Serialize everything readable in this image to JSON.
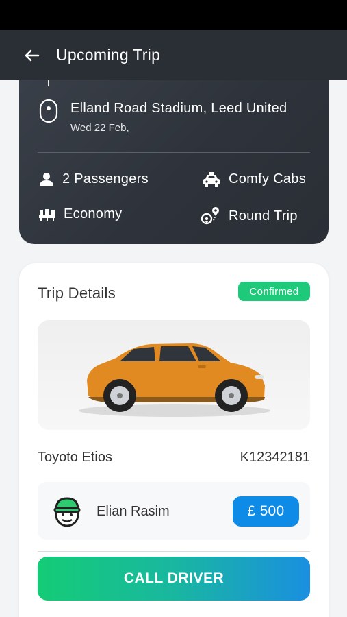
{
  "header": {
    "title": "Upcoming Trip",
    "back_icon": "arrow-left-icon"
  },
  "trip": {
    "location": "Elland Road Stadium, Leed United",
    "date": "Wed 22 Feb,",
    "passengers": "2 Passengers",
    "cab_company": "Comfy Cabs",
    "class": "Economy",
    "trip_type": "Round Trip"
  },
  "details": {
    "title": "Trip Details",
    "status": "Confirmed",
    "car_model": "Toyoto Etios",
    "car_plate": "K12342181",
    "driver_name": "Elian Rasim",
    "price": "£ 500",
    "call_label": "CALL DRIVER"
  },
  "colors": {
    "header_bg": "#2a2f36",
    "status_green": "#1ec97a",
    "price_blue": "#0d8be6",
    "car_orange": "#e28a22"
  }
}
